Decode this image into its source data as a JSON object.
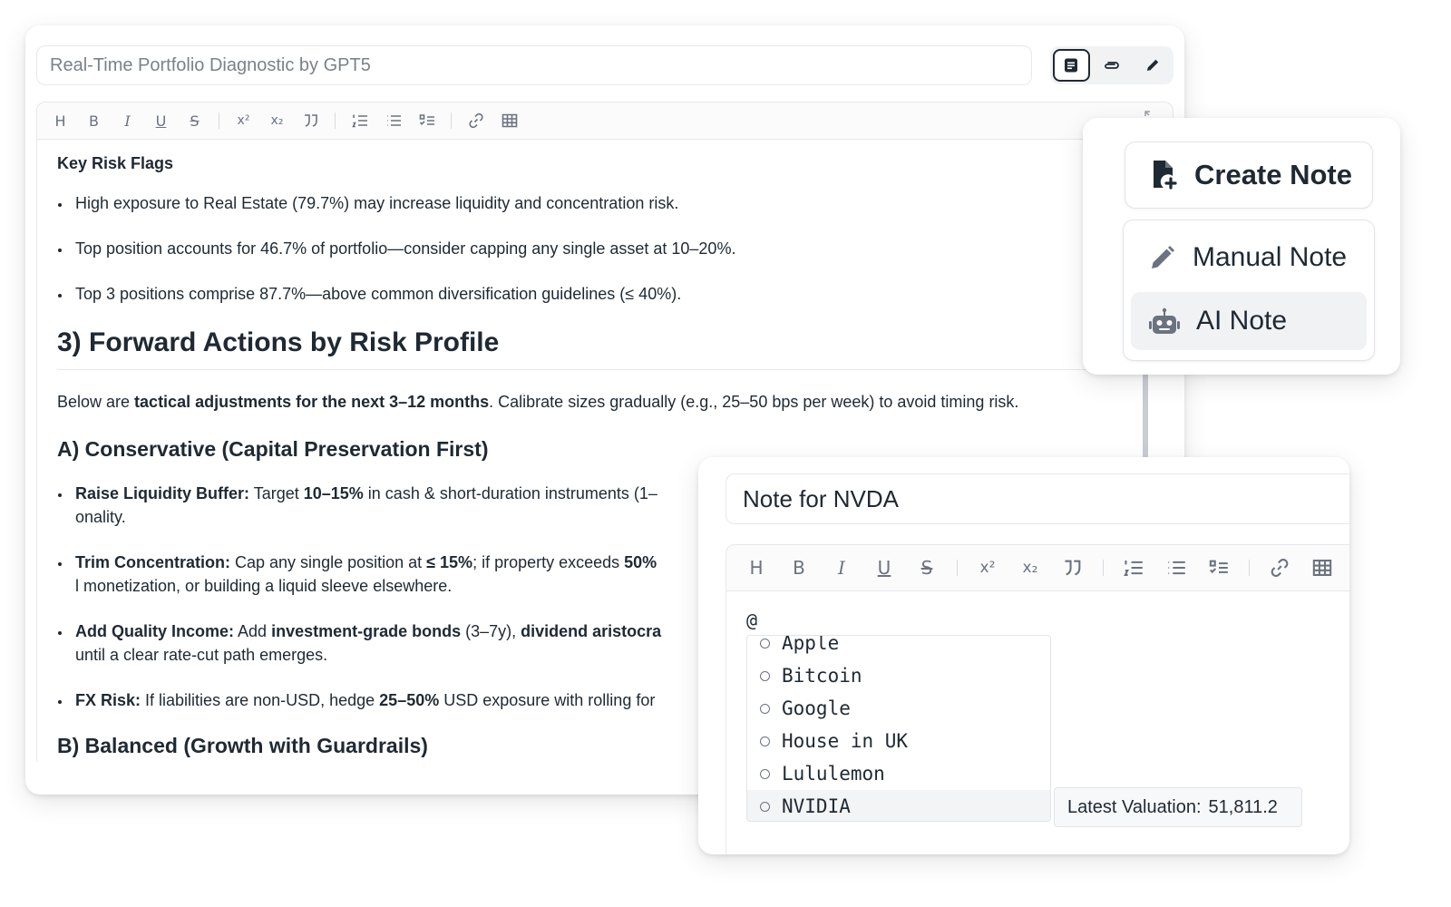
{
  "main": {
    "title": "Real-Time Portfolio Diagnostic by GPT5",
    "risk_heading": "Key Risk Flags",
    "risk_items": [
      "High exposure to Real Estate (79.7%) may increase liquidity and concentration risk.",
      "Top position accounts for 46.7% of portfolio—consider capping any single asset at 10–20%.",
      "Top 3 positions comprise 87.7%—above common diversification guidelines (≤ 40%)."
    ],
    "section_title": "3) Forward Actions by Risk Profile",
    "intro": {
      "pre": "Below are ",
      "bold": "tactical adjustments for the next 3–12 months",
      "post": ". Calibrate sizes gradually (e.g., 25–50 bps per week) to avoid timing risk."
    },
    "conservative_title": "A) Conservative (Capital Preservation First)",
    "conservative_items": [
      {
        "b1": "Raise Liquidity Buffer:",
        "t1": " Target ",
        "b2": "10–15%",
        "t2": " in cash & short-duration instruments (1–",
        "line2": "onality."
      },
      {
        "b1": "Trim Concentration:",
        "t1": " Cap any single position at ",
        "b2": "≤ 15%",
        "t2": "; if property exceeds ",
        "b3": "50%",
        "line2": "l monetization, or building a liquid sleeve elsewhere."
      },
      {
        "b1": "Add Quality Income:",
        "t1": " Add ",
        "b2": "investment-grade bonds",
        "t2": " (3–7y), ",
        "b3": "dividend aristocra",
        "line2": "until a clear rate-cut path emerges."
      },
      {
        "b1": "FX Risk:",
        "t1": " If liabilities are non-USD, hedge ",
        "b2": "25–50%",
        "t2": " USD exposure with rolling for"
      }
    ],
    "balanced_title": "B) Balanced (Growth with Guardrails)"
  },
  "popup": {
    "create_label": "Create Note",
    "manual_label": "Manual Note",
    "ai_label": "AI Note"
  },
  "note": {
    "title": "Note for NVDA",
    "mention_trigger": "@",
    "options": [
      "Apple",
      "Bitcoin",
      "Google",
      "House in UK",
      "Lululemon",
      "NVIDIA"
    ],
    "selected_option": "NVIDIA",
    "tooltip_label": "Latest Valuation:",
    "tooltip_value": "51,811.2"
  },
  "toolbar": {
    "heading": "H",
    "bold": "B",
    "italic": "I",
    "underline": "U",
    "strike": "S",
    "superscript": "x²",
    "subscript": "x₂"
  }
}
